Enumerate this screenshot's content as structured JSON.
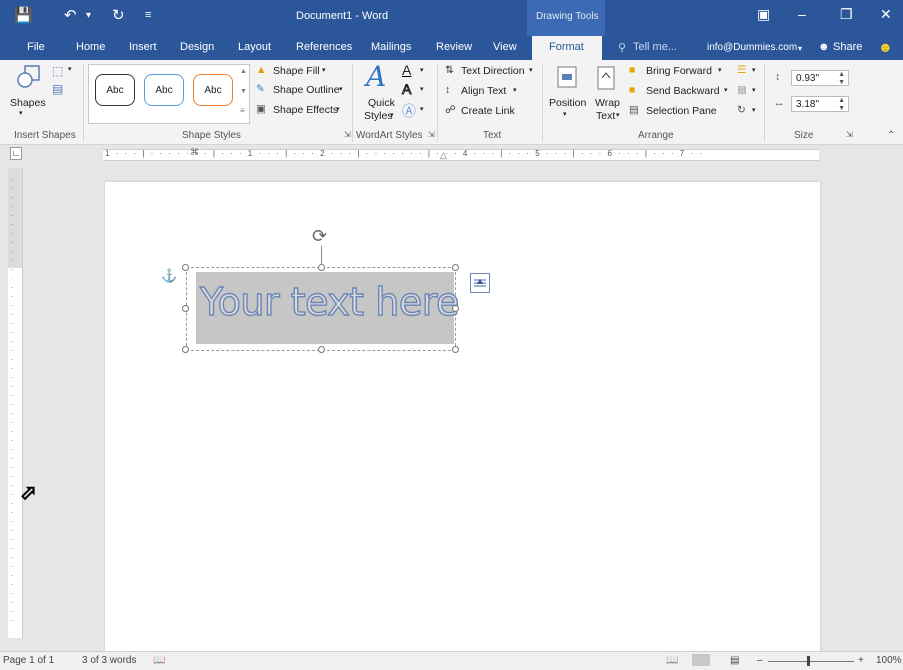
{
  "window": {
    "title": "Document1 - Word",
    "contextual_tab_group": "Drawing Tools",
    "qat_save_icon": "save-icon",
    "qat_undo_icon": "undo-icon",
    "qat_redo_icon": "redo-icon"
  },
  "tabs": [
    "File",
    "Home",
    "Insert",
    "Design",
    "Layout",
    "References",
    "Mailings",
    "Review",
    "View",
    "Format"
  ],
  "tell_me": "Tell me...",
  "account": "info@Dummies.com",
  "share": "Share",
  "ribbon": {
    "insert_shapes": {
      "label": "Insert Shapes",
      "shapes_btn": "Shapes"
    },
    "shape_styles": {
      "label": "Shape Styles",
      "thumbs": [
        "Abc",
        "Abc",
        "Abc"
      ],
      "fill": "Shape Fill",
      "outline": "Shape Outline",
      "effects": "Shape Effects"
    },
    "wordart": {
      "label": "WordArt Styles",
      "quick1": "Quick",
      "quick2": "Styles"
    },
    "text": {
      "label": "Text",
      "direction": "Text Direction",
      "align": "Align Text",
      "link": "Create Link"
    },
    "arrange": {
      "label": "Arrange",
      "position": "Position",
      "wrap1": "Wrap",
      "wrap2": "Text",
      "bring_forward": "Bring Forward",
      "send_backward": "Send Backward",
      "selection_pane": "Selection Pane"
    },
    "size": {
      "label": "Size",
      "height": "0.93\"",
      "width": "3.18\""
    }
  },
  "document": {
    "textbox_text": "Your text here"
  },
  "statusbar": {
    "page": "Page 1 of 1",
    "words": "3 of 3 words",
    "zoom": "100%"
  },
  "colors": {
    "accent": "#2b579a",
    "wordart_outline": "#6b86b5"
  }
}
